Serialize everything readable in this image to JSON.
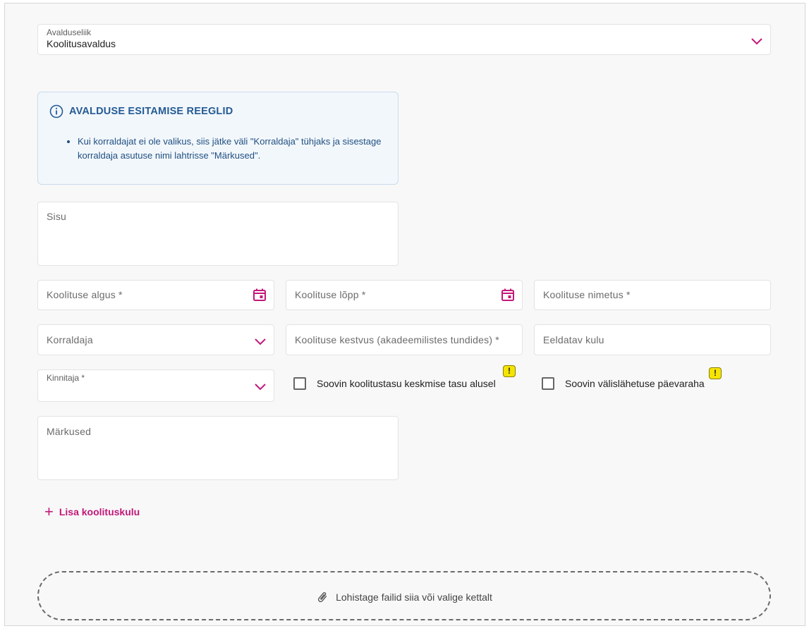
{
  "application_type": {
    "label": "Avalduseliik",
    "value": "Koolitusavaldus"
  },
  "info": {
    "title": "AVALDUSE ESITAMISE REEGLID",
    "items": [
      "Kui korraldajat ei ole valikus, siis jätke väli \"Korraldaja\" tühjaks ja sisestage korraldaja asutuse nimi lahtrisse \"Märkused\"."
    ]
  },
  "fields": {
    "sisu": "Sisu",
    "start": "Koolituse algus *",
    "end": "Koolituse lõpp *",
    "name": "Koolituse nimetus *",
    "organizer": "Korraldaja",
    "duration": "Koolituse kestvus (akadeemilistes tundides) *",
    "cost": "Eeldatav kulu",
    "approver": "Kinnitaja *",
    "notes": "Märkused"
  },
  "checkboxes": {
    "average_pay": "Soovin koolitustasu keskmise tasu alusel",
    "per_diem": "Soovin välislähetuse päevaraha"
  },
  "add_cost_label": "Lisa koolituskulu",
  "dropzone_label": "Lohistage failid siia või valige kettalt",
  "accent_color": "#c2187a"
}
